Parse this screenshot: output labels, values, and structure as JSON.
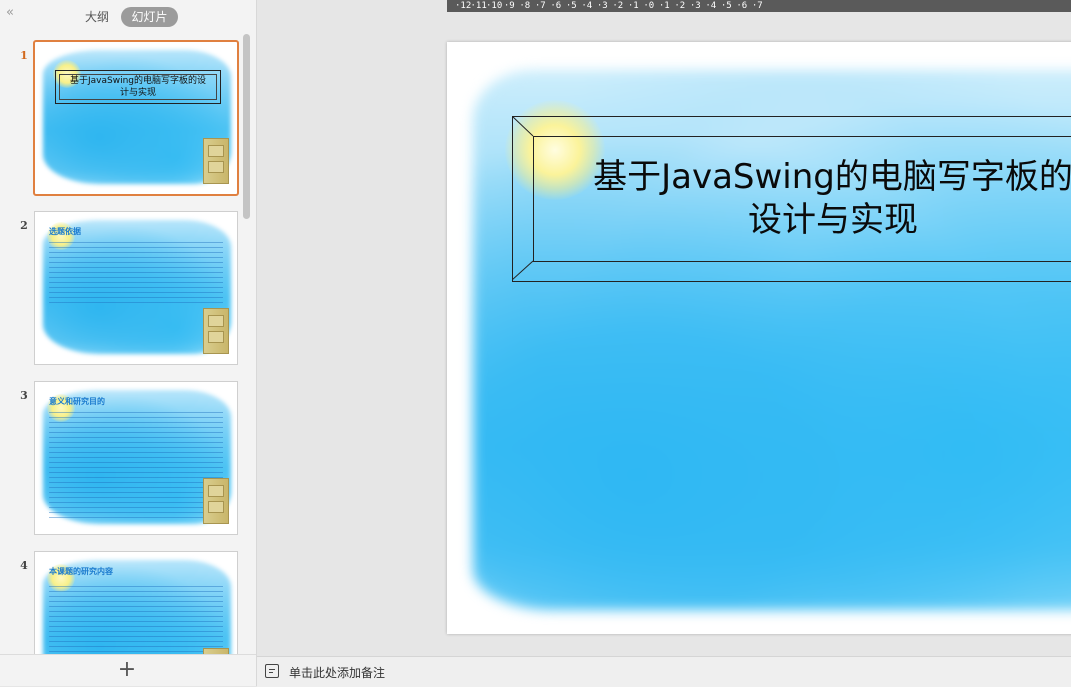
{
  "left_panel": {
    "tabs": [
      {
        "label": "大纲"
      },
      {
        "label": "幻灯片"
      }
    ],
    "slides": [
      {
        "number": "1",
        "title": "基于JavaSwing的电脑写字板的设计与实现",
        "active": true
      },
      {
        "number": "2",
        "heading": "选题依据"
      },
      {
        "number": "3",
        "heading": "意义和研究目的"
      },
      {
        "number": "4",
        "heading": "本课题的研究内容"
      }
    ],
    "add_slide_icon": "plus-icon",
    "collapse_icon": "double-chevron-left-icon"
  },
  "ruler": {
    "labels": [
      "12",
      "11",
      "10",
      "9",
      "8",
      "7",
      "6",
      "5",
      "4",
      "3",
      "2",
      "1",
      "0",
      "1",
      "2",
      "3",
      "4",
      "5",
      "6",
      "7"
    ]
  },
  "slide": {
    "title_line1": "基于JavaSwing的电脑写字板的",
    "title_line2": "设计与实现"
  },
  "notes": {
    "placeholder": "单击此处添加备注"
  },
  "colors": {
    "active_accent": "#e08040",
    "tab_selected_bg": "#9b9b9b",
    "sky_blue": "#33bdf5"
  }
}
